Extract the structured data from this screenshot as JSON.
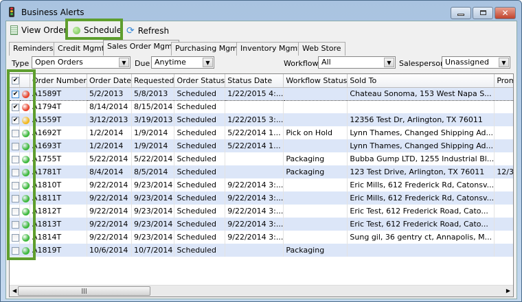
{
  "window": {
    "title": "Business Alerts",
    "minimize": "—",
    "maximize": "□",
    "close": "✕"
  },
  "toolbar": {
    "view_order": "View Order",
    "schedule": "Schedule",
    "refresh": "Refresh"
  },
  "tabs": [
    {
      "label": "Reminders"
    },
    {
      "label": "Credit Mgmt"
    },
    {
      "label": "Sales Order Mgmt",
      "active": true
    },
    {
      "label": "Purchasing Mgmt"
    },
    {
      "label": "Inventory Mgmt"
    },
    {
      "label": "Web Store"
    }
  ],
  "filters": {
    "type_label": "Type",
    "type_value": "Open Orders",
    "due_label": "Due",
    "due_value": "Anytime",
    "workflow_label": "Workflow",
    "workflow_value": "All",
    "salesperson_label": "Salesperson",
    "salesperson_value": "Unassigned"
  },
  "colors": {
    "red": "#e8432c",
    "yellow": "#f2b81c",
    "green": "#3cb83c",
    "highlight": "#5e9e2e"
  },
  "grid": {
    "columns": [
      "",
      "",
      "Order Number",
      "Order Date",
      "Requested",
      "Order Status",
      "Status Date",
      "Workflow Status",
      "Sold To",
      "Prom"
    ],
    "rows": [
      {
        "checked": true,
        "status": "red",
        "cells": [
          "A1589T",
          "5/2/2013",
          "5/8/2013",
          "Scheduled",
          "1/22/2015 4:...",
          "",
          "Chateau Sonoma, 153 West Napa S...",
          ""
        ]
      },
      {
        "checked": true,
        "status": "red",
        "cells": [
          "A1794T",
          "8/14/2014",
          "8/15/2014",
          "Scheduled",
          "",
          "",
          "",
          ""
        ]
      },
      {
        "checked": true,
        "status": "yellow",
        "cells": [
          "A1559T",
          "3/12/2013",
          "3/19/2013",
          "Scheduled",
          "1/22/2015 3:...",
          "",
          "12356 Test Dr, Arlington, TX 76011",
          ""
        ]
      },
      {
        "checked": false,
        "status": "green",
        "cells": [
          "A1692T",
          "1/2/2014",
          "1/9/2014",
          "Scheduled",
          "5/22/2014 1...",
          "Pick on Hold",
          "Lynn Thames, Changed Shipping Ad...",
          ""
        ]
      },
      {
        "checked": false,
        "status": "green",
        "cells": [
          "A1693T",
          "1/2/2014",
          "1/9/2014",
          "Scheduled",
          "5/22/2014 1...",
          "",
          "Lynn Thames, Changed Shipping Ad...",
          ""
        ]
      },
      {
        "checked": false,
        "status": "green",
        "cells": [
          "A1755T",
          "5/22/2014",
          "5/22/2014",
          "Scheduled",
          "",
          "Packaging",
          "Bubba Gump LTD, 1255 Industrial Bl...",
          ""
        ]
      },
      {
        "checked": false,
        "status": "green",
        "cells": [
          "A1781T",
          "8/4/2014",
          "8/5/2014",
          "Scheduled",
          "",
          "Packaging",
          "123 Test Drive, Arlington, TX 76011",
          "12/3"
        ]
      },
      {
        "checked": false,
        "status": "green",
        "cells": [
          "A1810T",
          "9/22/2014",
          "9/23/2014",
          "Scheduled",
          "9/22/2014 3:...",
          "",
          "Eric Mills, 612 Frederick Rd, Catonsv...",
          ""
        ]
      },
      {
        "checked": false,
        "status": "green",
        "cells": [
          "A1811T",
          "9/22/2014",
          "9/23/2014",
          "Scheduled",
          "9/22/2014 3:...",
          "",
          "Eric Mills, 612 Frederick Rd, Catonsv...",
          ""
        ]
      },
      {
        "checked": false,
        "status": "green",
        "cells": [
          "A1812T",
          "9/22/2014",
          "9/23/2014",
          "Scheduled",
          "9/22/2014 3:...",
          "",
          "Eric Test, 612 Frederick Road, Cato...",
          ""
        ]
      },
      {
        "checked": false,
        "status": "green",
        "cells": [
          "A1813T",
          "9/22/2014",
          "9/23/2014",
          "Scheduled",
          "9/22/2014 3:...",
          "",
          "Eric Test, 612 Frederick Road, Cato...",
          ""
        ]
      },
      {
        "checked": false,
        "status": "green",
        "cells": [
          "A1814T",
          "9/22/2014",
          "9/23/2014",
          "Scheduled",
          "9/22/2014 3:...",
          "",
          "Sung gil, 36 gentry ct, Annapolis, M...",
          ""
        ]
      },
      {
        "checked": false,
        "status": "green",
        "cells": [
          "A1819T",
          "10/6/2014",
          "10/7/2014",
          "Scheduled",
          "",
          "Packaging",
          "",
          ""
        ]
      }
    ]
  }
}
